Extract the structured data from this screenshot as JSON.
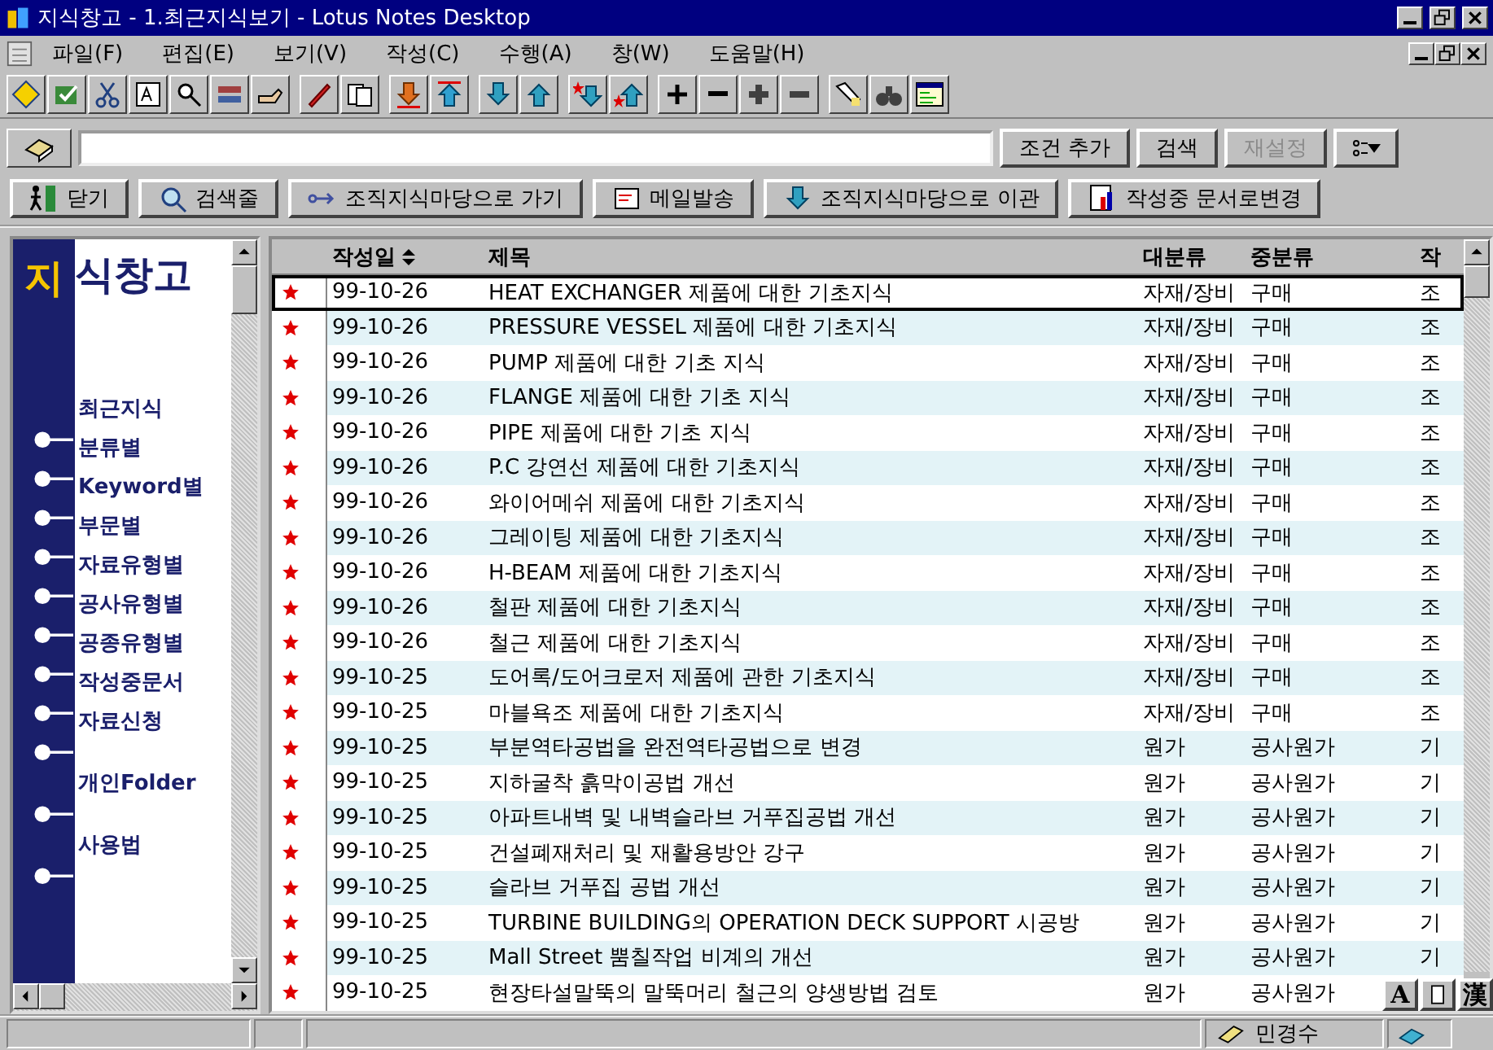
{
  "window": {
    "title": "지식창고 - 1.최근지식보기 - Lotus Notes Desktop"
  },
  "menu": [
    "파일(F)",
    "편집(E)",
    "보기(V)",
    "작성(C)",
    "수행(A)",
    "창(W)",
    "도움말(H)"
  ],
  "search": {
    "buttons": [
      {
        "label": "조건 추가",
        "disabled": false
      },
      {
        "label": "검색",
        "disabled": false
      },
      {
        "label": "재설정",
        "disabled": true
      }
    ]
  },
  "actions": [
    {
      "label": "닫기",
      "kind": "door"
    },
    {
      "label": "검색줄",
      "kind": "magnifier"
    },
    {
      "label": "조직지식마당으로 가기",
      "kind": "arrow"
    },
    {
      "label": "메일발송",
      "kind": "mail"
    },
    {
      "label": "조직지식마당으로 이관",
      "kind": "down"
    },
    {
      "label": "작성중 문서로변경",
      "kind": "doc"
    }
  ],
  "sidebar": {
    "logo_mark": "지",
    "logo_text": "식창고",
    "items": [
      "최근지식",
      "분류별",
      "Keyword별",
      "부문별",
      "자료유형별",
      "공사유형별",
      "공종유형별",
      "작성중문서",
      "자료신청",
      "개인Folder",
      "사용법"
    ]
  },
  "table": {
    "columns": [
      "작성일",
      "제목",
      "대분류",
      "중분류",
      "작"
    ],
    "rows": [
      {
        "starred": true,
        "selected": true,
        "date": "99-10-26",
        "title": "HEAT EXCHANGER 제품에 대한 기초지식",
        "category": "자재/장비",
        "subcategory": "구매",
        "column_5": "조"
      },
      {
        "starred": true,
        "selected": false,
        "date": "99-10-26",
        "title": "PRESSURE VESSEL 제품에 대한 기초지식",
        "category": "자재/장비",
        "subcategory": "구매",
        "column_5": "조"
      },
      {
        "starred": true,
        "selected": false,
        "date": "99-10-26",
        "title": "PUMP 제품에 대한 기초 지식",
        "category": "자재/장비",
        "subcategory": "구매",
        "column_5": "조"
      },
      {
        "starred": true,
        "selected": false,
        "date": "99-10-26",
        "title": "FLANGE 제품에 대한 기초 지식",
        "category": "자재/장비",
        "subcategory": "구매",
        "column_5": "조"
      },
      {
        "starred": true,
        "selected": false,
        "date": "99-10-26",
        "title": "PIPE 제품에 대한 기초 지식",
        "category": "자재/장비",
        "subcategory": "구매",
        "column_5": "조"
      },
      {
        "starred": true,
        "selected": false,
        "date": "99-10-26",
        "title": "P.C 강연선 제품에 대한 기초지식",
        "category": "자재/장비",
        "subcategory": "구매",
        "column_5": "조"
      },
      {
        "starred": true,
        "selected": false,
        "date": "99-10-26",
        "title": "와이어메쉬 제품에 대한 기초지식",
        "category": "자재/장비",
        "subcategory": "구매",
        "column_5": "조"
      },
      {
        "starred": true,
        "selected": false,
        "date": "99-10-26",
        "title": "그레이팅 제품에 대한 기초지식",
        "category": "자재/장비",
        "subcategory": "구매",
        "column_5": "조"
      },
      {
        "starred": true,
        "selected": false,
        "date": "99-10-26",
        "title": "H-BEAM 제품에 대한 기초지식",
        "category": "자재/장비",
        "subcategory": "구매",
        "column_5": "조"
      },
      {
        "starred": true,
        "selected": false,
        "date": "99-10-26",
        "title": "철판  제품에 대한 기초지식",
        "category": "자재/장비",
        "subcategory": "구매",
        "column_5": "조"
      },
      {
        "starred": true,
        "selected": false,
        "date": "99-10-26",
        "title": "철근  제품에 대한 기초지식",
        "category": "자재/장비",
        "subcategory": "구매",
        "column_5": "조"
      },
      {
        "starred": true,
        "selected": false,
        "date": "99-10-25",
        "title": "도어록/도어크로저 제품에 관한 기초지식",
        "category": "자재/장비",
        "subcategory": "구매",
        "column_5": "조"
      },
      {
        "starred": true,
        "selected": false,
        "date": "99-10-25",
        "title": "마블욕조  제품에 대한 기초지식",
        "category": "자재/장비",
        "subcategory": "구매",
        "column_5": "조"
      },
      {
        "starred": true,
        "selected": false,
        "date": "99-10-25",
        "title": "부분역타공법을 완전역타공법으로 변경",
        "category": "원가",
        "subcategory": "공사원가",
        "column_5": "기"
      },
      {
        "starred": true,
        "selected": false,
        "date": "99-10-25",
        "title": "지하굴착 흙막이공법 개선",
        "category": "원가",
        "subcategory": "공사원가",
        "column_5": "기"
      },
      {
        "starred": true,
        "selected": false,
        "date": "99-10-25",
        "title": "아파트내벽 및 내벽슬라브 거푸집공법 개선",
        "category": "원가",
        "subcategory": "공사원가",
        "column_5": "기"
      },
      {
        "starred": true,
        "selected": false,
        "date": "99-10-25",
        "title": "건설폐재처리 및 재활용방안 강구",
        "category": "원가",
        "subcategory": "공사원가",
        "column_5": "기"
      },
      {
        "starred": true,
        "selected": false,
        "date": "99-10-25",
        "title": "슬라브 거푸집 공법 개선",
        "category": "원가",
        "subcategory": "공사원가",
        "column_5": "기"
      },
      {
        "starred": true,
        "selected": false,
        "date": "99-10-25",
        "title": "TURBINE BUILDING의 OPERATION DECK SUPPORT 시공방",
        "category": "원가",
        "subcategory": "공사원가",
        "column_5": "기"
      },
      {
        "starred": true,
        "selected": false,
        "date": "99-10-25",
        "title": "Mall Street 뿜칠작업 비계의 개선",
        "category": "원가",
        "subcategory": "공사원가",
        "column_5": "기"
      },
      {
        "starred": true,
        "selected": false,
        "date": "99-10-25",
        "title": "현장타설말뚝의 말뚝머리 철근의 양생방법 검토",
        "category": "원가",
        "subcategory": "공사원가"
      }
    ]
  },
  "status_bar": {
    "user": "민경수",
    "ime_mode": "A",
    "ime_hanja": "漢"
  }
}
